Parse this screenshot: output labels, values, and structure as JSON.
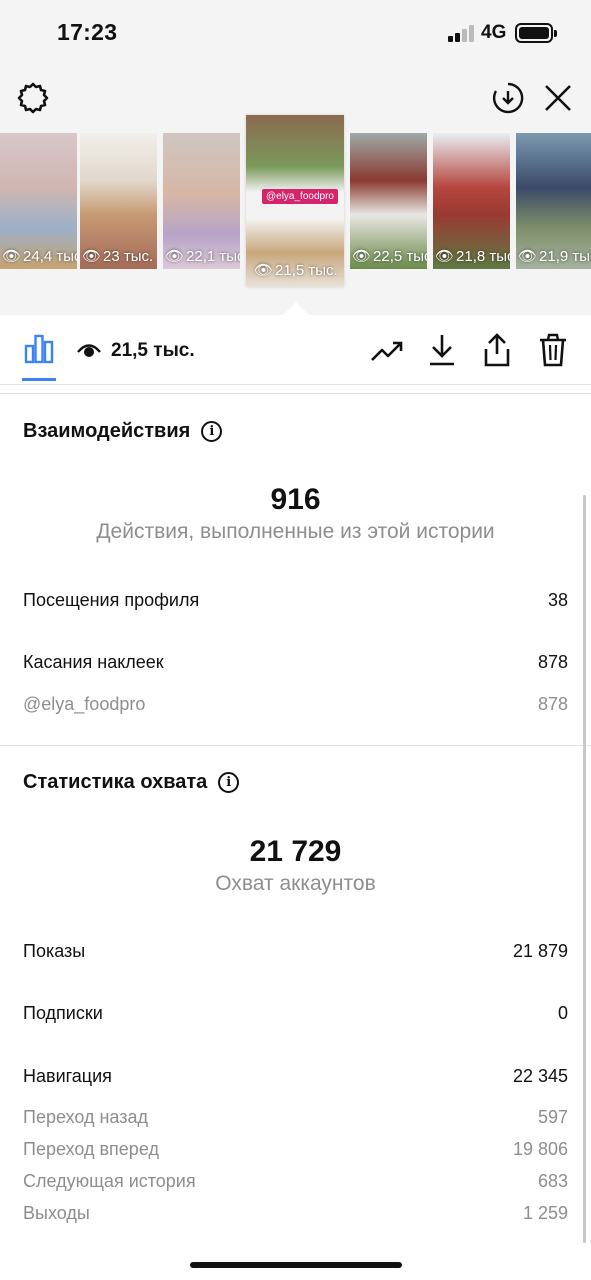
{
  "status_bar": {
    "time": "17:23",
    "network": "4G"
  },
  "thumbnails": [
    {
      "views": "24,4 тыс."
    },
    {
      "views": "23 тыс."
    },
    {
      "views": "22,1 тыс."
    },
    {
      "views": "21,5 тыс.",
      "active": true,
      "sticker": "@elya_foodpro"
    },
    {
      "views": "22,5 тыс."
    },
    {
      "views": "21,8 тыс."
    },
    {
      "views": "21,9 тыс."
    }
  ],
  "tab_row": {
    "view_count": "21,5 тыс."
  },
  "interactions": {
    "title": "Взаимодействия",
    "total": "916",
    "caption": "Действия, выполненные из этой истории",
    "rows": [
      {
        "label": "Посещения профиля",
        "value": "38"
      },
      {
        "label": "Касания наклеек",
        "value": "878"
      },
      {
        "label": "@elya_foodpro",
        "value": "878"
      }
    ]
  },
  "reach": {
    "title": "Статистика охвата",
    "total": "21 729",
    "caption": "Охват аккаунтов",
    "rows": [
      {
        "label": "Показы",
        "value": "21 879"
      },
      {
        "label": "Подписки",
        "value": "0"
      },
      {
        "label": "Навигация",
        "value": "22 345"
      },
      {
        "label": "Переход назад",
        "value": "597"
      },
      {
        "label": "Переход вперед",
        "value": "19 806"
      },
      {
        "label": "Следующая история",
        "value": "683"
      },
      {
        "label": "Выходы",
        "value": "1 259"
      }
    ]
  },
  "colors": {
    "accent": "#3b82f6",
    "muted": "#8e8e8e"
  }
}
